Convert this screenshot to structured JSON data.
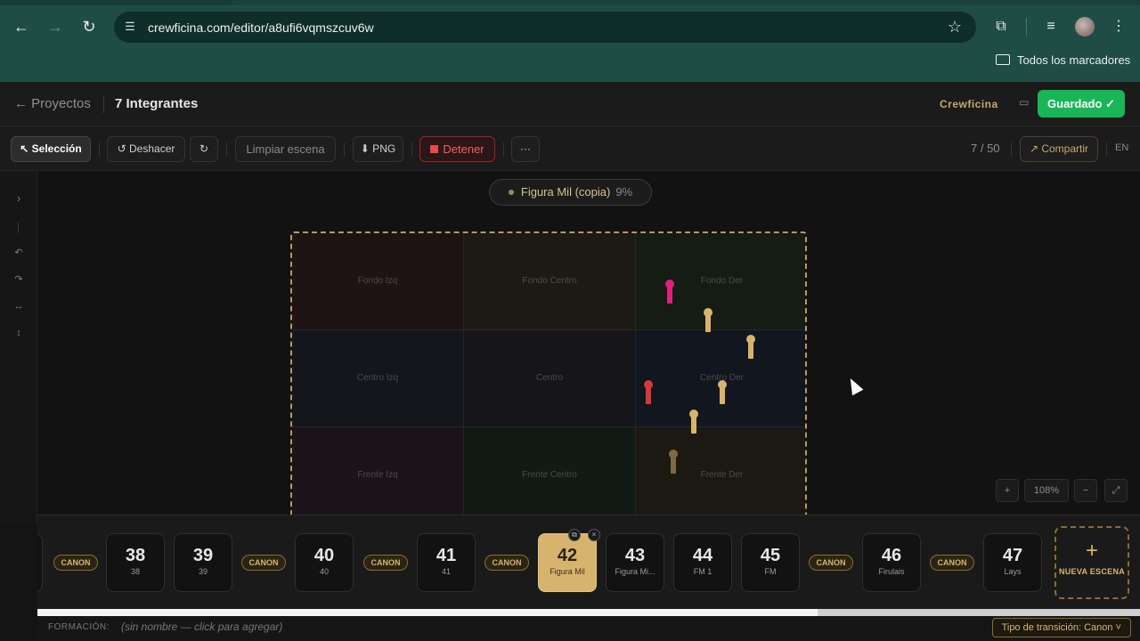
{
  "browser": {
    "url": "crewficina.com/editor/a8ufi6vqmszcuv6w",
    "bookmarks_label": "Todos los marcadores"
  },
  "header": {
    "back_label": "← Proyectos",
    "project_title": "7 Integrantes",
    "brand": "Crewficina",
    "saved_label": "Guardado ✓"
  },
  "toolbar": {
    "select_label": "↖ Selección",
    "undo_label": "↺ Deshacer",
    "redo_label": "↻",
    "clear_label": "Limpiar escena",
    "png_label": "⬇ PNG",
    "stop_label": "Detener",
    "more_label": "···",
    "scene_counter": "7 / 50",
    "share_label": "↗ Compartir",
    "lang": "EN"
  },
  "canvas": {
    "figure_name": "Figura Mil (copia)",
    "figure_percent": "9%",
    "zones": [
      "Fondo Izq",
      "Fondo Centro",
      "Fondo Der",
      "Centro Izq",
      "Centro",
      "Centro Der",
      "Frente Izq",
      "Frente Centro",
      "Frente Der"
    ],
    "zoom": {
      "plus": "+",
      "level": "108%",
      "minus": "−",
      "fit": "⤢"
    },
    "dancer_colors": [
      "#e0207e",
      "#d8b46a",
      "#d8b46a",
      "#d23a3a",
      "#d8b46a",
      "#d8b46a",
      "#7a6a45"
    ]
  },
  "timeline": {
    "canon_label": "CANON",
    "scenes": [
      {
        "num": "38",
        "sub": "38"
      },
      {
        "num": "39",
        "sub": "39"
      },
      {
        "num": "40",
        "sub": "40"
      },
      {
        "num": "41",
        "sub": "41"
      },
      {
        "num": "42",
        "sub": "Figura Mil"
      },
      {
        "num": "43",
        "sub": "Figura Mi..."
      },
      {
        "num": "44",
        "sub": "FM 1"
      },
      {
        "num": "45",
        "sub": "FM"
      },
      {
        "num": "46",
        "sub": "Firulais"
      },
      {
        "num": "47",
        "sub": "Lays"
      }
    ],
    "new_scene_plus": "+",
    "new_scene_label": "NUEVA ESCENA"
  },
  "footer": {
    "formation_label": "FORMACIÓN:",
    "formation_hint": "(sin nombre — click para agregar)",
    "transition_label": "Tipo de transición: Canon ˅"
  }
}
